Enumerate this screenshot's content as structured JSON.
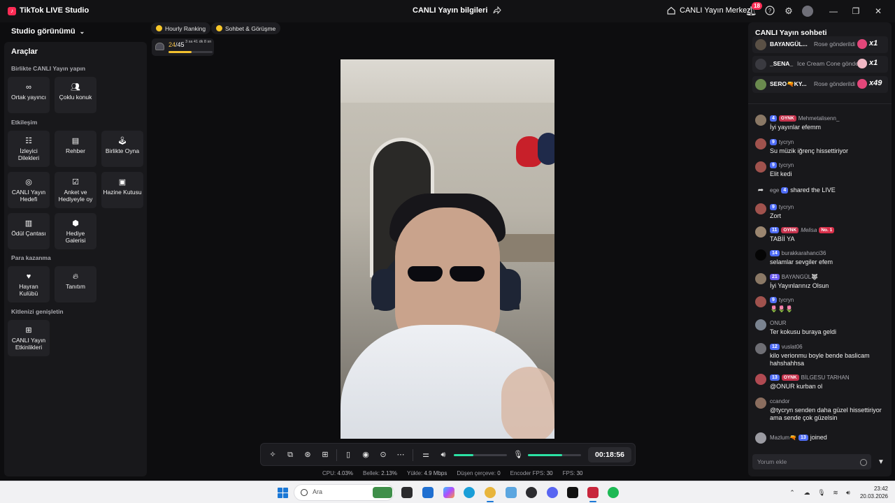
{
  "app": {
    "title": "TikTok LIVE Studio",
    "stream_info": "CANLI Yayın bilgileri",
    "center": "CANLI Yayın Merkezi",
    "notifications": "18"
  },
  "sidebar": {
    "studio_view": "Studio görünümü",
    "tools_heading": "Araçlar",
    "group_live_together": "Birlikte CANLI Yayın yapın",
    "group_interaction": "Etkileşim",
    "group_monetize": "Para kazanma",
    "group_audience": "Kitlenizi genişletin",
    "tools": {
      "cohost": "Ortak yayıncı",
      "multi_guest": "Çoklu konuk",
      "viewer_wishes": "İzleyici Dilekleri",
      "guide": "Rehber",
      "play_together": "Birlikte Oyna",
      "live_goal": "CANLI Yayın Hedefi",
      "poll": "Anket ve Hediyeyle oy",
      "treasure": "Hazine Kutusu",
      "reward_bag": "Ödül Çantası",
      "gift_gallery": "Hediye Galerisi",
      "fan_club": "Hayran Kulübü",
      "promote": "Tanıtım",
      "live_events": "CANLI Yayın Etkinlikleri"
    }
  },
  "top_chips": {
    "hourly": "Hourly Ranking",
    "chat_meet": "Sohbet & Görüşme"
  },
  "ranking": {
    "current": "24",
    "total": "/45",
    "time": "3 sa 41 dk 8 sn",
    "progress": 0.53
  },
  "controls": {
    "timer": "00:18:56",
    "speaker_level": 0.37,
    "mic_level": 0.65
  },
  "stats": {
    "cpu_label": "CPU:",
    "cpu": "4.03%",
    "mem_label": "Bellek:",
    "mem": "2.13%",
    "upload_label": "Yükle:",
    "upload": "4.9 Mbps",
    "dropped_label": "Düşen çerçeve:",
    "dropped": "0",
    "encoder_label": "Encoder FPS:",
    "encoder": "30",
    "fps_label": "FPS:",
    "fps": "30"
  },
  "chat": {
    "title": "CANLI Yayın sohbeti",
    "gifts": [
      {
        "user": "BAYANGÜL...",
        "text": "Rose gönderildi",
        "count": "x1"
      },
      {
        "user": "_SENA_",
        "text": "Ice Cream Cone gönderildi",
        "count": "x1"
      },
      {
        "user": "SERO🔫KY...",
        "text": "Rose gönderildi",
        "count": "x49"
      }
    ],
    "messages": [
      {
        "level": "4",
        "fan": "OYNK",
        "user": "Mehmetalisenn_",
        "text": "İyi yayınlar efemm"
      },
      {
        "level": "9",
        "user": "tycryn",
        "text": "Su müzik iğrenç hissettiriyor"
      },
      {
        "level": "9",
        "user": "tycryn",
        "text": "Elit kedi"
      },
      {
        "user": "ege",
        "level": "4",
        "text": "shared the LIVE"
      },
      {
        "level": "9",
        "user": "tycryn",
        "text": "Zort"
      },
      {
        "level": "11",
        "fan": "OYNK",
        "user": "Melisa",
        "badge": "No. 1",
        "text": "TABİİ YA"
      },
      {
        "level": "14",
        "user": "burakkarahanci36",
        "text": "selamlar sevgiler efem"
      },
      {
        "level": "21",
        "user": "BAYANGÜL🐺",
        "text": "İyi Yayınlarınız Olsun"
      },
      {
        "level": "9",
        "user": "tycryn",
        "text": "🌷🌷🌷"
      },
      {
        "user": "ONUR",
        "text": "Ter kokusu buraya geldi"
      },
      {
        "level": "12",
        "user": "vuslat06",
        "text": "kilo verionmu boyle bende baslicam hahshahhsa"
      },
      {
        "level": "13",
        "fan": "OYNK",
        "user": "BİLGESU TARHAN",
        "text": "@ONUR kurban ol"
      },
      {
        "user": "ccandor",
        "text": "@tycryn senden daha güzel hissettiriyor ama sende çok güzelsin"
      },
      {
        "user": "Mazlum🔫",
        "level": "13",
        "text": "joined"
      }
    ],
    "input_placeholder": "Yorum ekle"
  },
  "taskbar": {
    "search": "Ara",
    "time": "23:42",
    "date": "20.03.2026"
  },
  "colors": {
    "accent": "#fe2c55",
    "volume": "#2be2a4",
    "level_badge": "#4e6cf5",
    "ranking": "#f3c12f"
  }
}
